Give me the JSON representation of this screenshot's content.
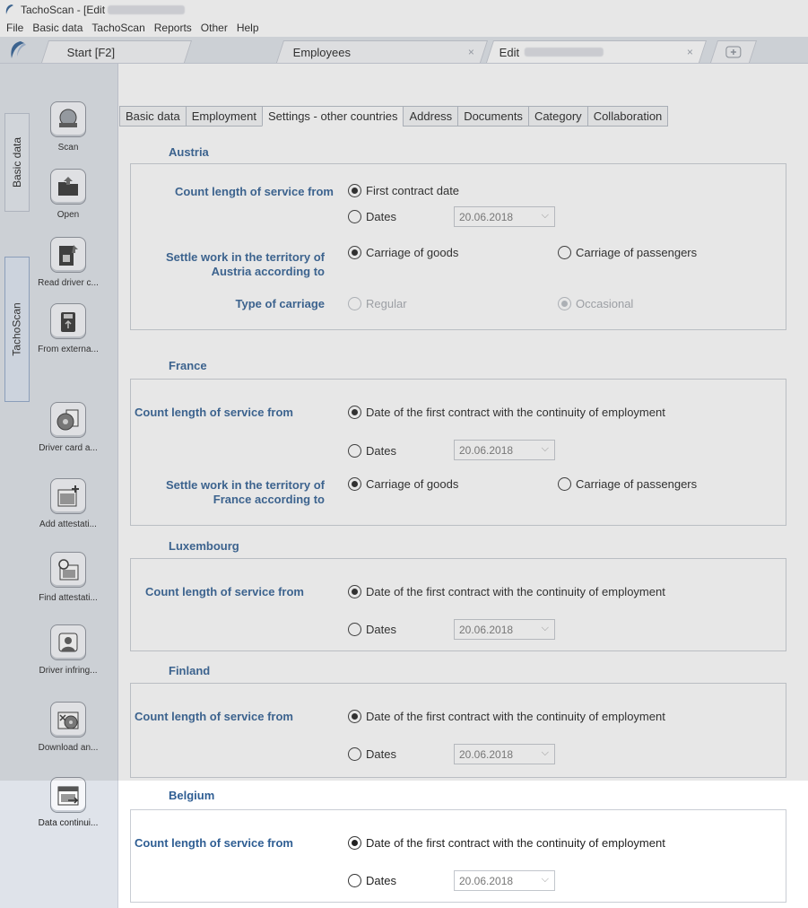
{
  "window": {
    "title_prefix": "TachoScan - [Edit"
  },
  "menu": [
    "File",
    "Basic data",
    "TachoScan",
    "Reports",
    "Other",
    "Help"
  ],
  "app_tabs": [
    {
      "label": "Start [F2]"
    },
    {
      "label": "Employees",
      "close": "×"
    },
    {
      "label": "Edit",
      "close": "×"
    }
  ],
  "vertical_tabs": [
    "Basic data",
    "TachoScan"
  ],
  "tools": [
    {
      "label": "Scan",
      "icon": "scanner-icon"
    },
    {
      "label": "Open",
      "icon": "folder-icon"
    },
    {
      "label": "Read driver c...",
      "icon": "card-reader-icon"
    },
    {
      "label": "From externa...",
      "icon": "usb-icon"
    },
    {
      "label": "Driver card a...",
      "icon": "disc-icon"
    },
    {
      "label": "Add attestati...",
      "icon": "calendar-add-icon"
    },
    {
      "label": "Find attestati...",
      "icon": "calendar-search-icon"
    },
    {
      "label": "Driver infring...",
      "icon": "driver-icon"
    },
    {
      "label": "Download an...",
      "icon": "download-icon"
    },
    {
      "label": "Data continui...",
      "icon": "calendar-arrow-icon"
    }
  ],
  "sub_tabs": [
    "Basic data",
    "Employment",
    "Settings - other countries",
    "Address",
    "Documents",
    "Category",
    "Collaboration"
  ],
  "sections": {
    "austria": {
      "title": "Austria",
      "count_label": "Count length of service from",
      "first_contract": "First contract date",
      "dates": "Dates",
      "date_value": "20.06.2018",
      "settle_label_1": "Settle work in the territory of",
      "settle_label_2": "Austria according to",
      "goods": "Carriage of goods",
      "passengers": "Carriage of passengers",
      "type_label": "Type of carriage",
      "regular": "Regular",
      "occasional": "Occasional"
    },
    "france": {
      "title": "France",
      "count_label": "Count length of service from",
      "first_contract": "Date of the first contract with the continuity of employment",
      "dates": "Dates",
      "date_value": "20.06.2018",
      "settle_label_1": "Settle work in the territory of",
      "settle_label_2": "France according to",
      "goods": "Carriage of goods",
      "passengers": "Carriage of passengers"
    },
    "luxembourg": {
      "title": "Luxembourg",
      "count_label": "Count length of service from",
      "first_contract": "Date of the first contract with the continuity of employment",
      "dates": "Dates",
      "date_value": "20.06.2018"
    },
    "finland": {
      "title": "Finland",
      "count_label": "Count length of service from",
      "first_contract": "Date of the first contract with the continuity of employment",
      "dates": "Dates",
      "date_value": "20.06.2018"
    },
    "belgium": {
      "title": "Belgium",
      "count_label": "Count length of service from",
      "first_contract": "Date of the first contract with the continuity of employment",
      "dates": "Dates",
      "date_value": "20.06.2018"
    }
  },
  "colors": {
    "accent": "#2f5e93",
    "chrome": "#dfe3ea"
  }
}
